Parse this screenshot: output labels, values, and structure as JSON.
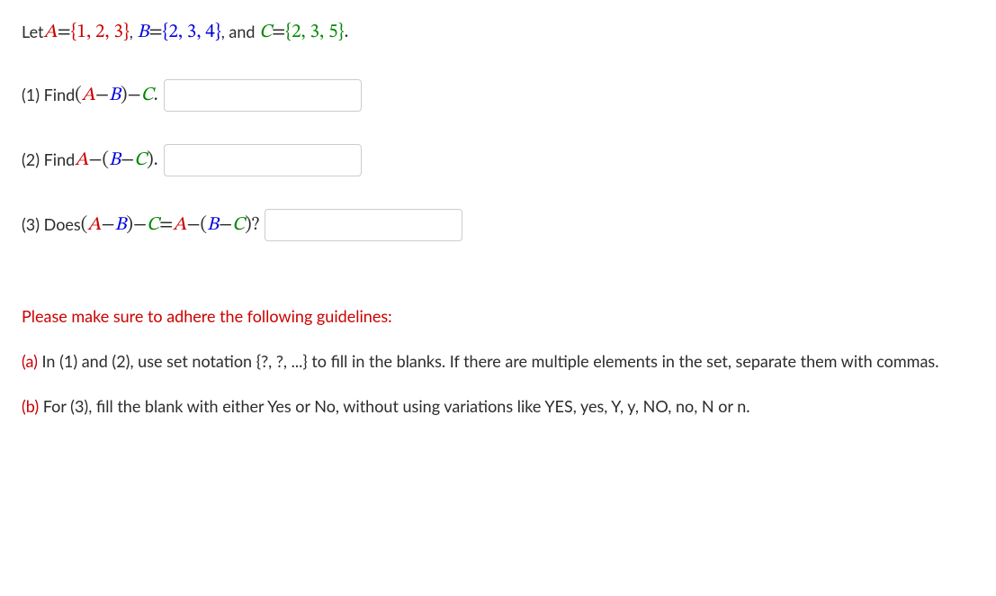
{
  "problem": {
    "let_prefix": "Let ",
    "set_A_var": "A",
    "equals": " = ",
    "set_A_val": "{1, 2, 3}",
    "comma1": ", ",
    "set_B_var": "B",
    "set_B_val": "{2, 3, 4}",
    "and_text": ", and ",
    "set_C_var": "C",
    "set_C_val": "{2, 3, 5}",
    "period": "."
  },
  "q1": {
    "label": "(1) Find ",
    "expr_open": "(",
    "A": "A",
    "minus": " − ",
    "B": "B",
    "expr_close": ")",
    "C": "C",
    "end": "."
  },
  "q2": {
    "label": "(2) Find ",
    "A": "A",
    "minus": " − ",
    "open": "(",
    "B": "B",
    "C": "C",
    "close": ")",
    "end": "."
  },
  "q3": {
    "label": "(3) Does ",
    "open1": "(",
    "A1": "A",
    "minus": " − ",
    "B1": "B",
    "close1": ")",
    "C1": "C",
    "eq": " = ",
    "A2": "A",
    "open2": "(",
    "B2": "B",
    "C2": "C",
    "close2": ")",
    "qmark": "?"
  },
  "guidelines": {
    "title": "Please make sure to adhere the following guidelines:",
    "a_label": "(a)",
    "a_text": " In (1) and (2),  use set notation {?, ?, ...} to fill in the blanks. If there are multiple elements in the set, separate them with commas.",
    "b_label": "(b)",
    "b_text": " For (3), fill the blank with either Yes or No, without using variations like YES, yes, Y, y, NO, no, N or n."
  }
}
